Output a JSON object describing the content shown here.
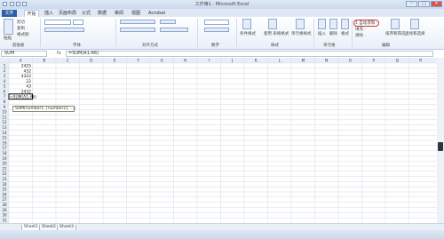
{
  "window": {
    "title": "工作簿1 - Microsoft Excel",
    "minimize_symbol": "–",
    "maximize_symbol": "□",
    "close_symbol": "✕"
  },
  "tabs": [
    {
      "label": "文件"
    },
    {
      "label": "开始"
    },
    {
      "label": "插入"
    },
    {
      "label": "页面布局"
    },
    {
      "label": "公式"
    },
    {
      "label": "数据"
    },
    {
      "label": "审阅"
    },
    {
      "label": "视图"
    },
    {
      "label": "Acrobat"
    }
  ],
  "ribbon": {
    "clipboard": {
      "cut": "剪切",
      "copy": "复制 ·",
      "format_painter": "格式刷",
      "paste": "粘贴",
      "group": "剪贴板"
    },
    "font_group": "字体",
    "alignment_group": "对齐方式",
    "number_group": "数字",
    "styles": {
      "conditional": "条件格式",
      "table": "套用 表格格式",
      "cell": "单元格样式",
      "group": "样式"
    },
    "cells": {
      "insert": "插入",
      "delete": "删除",
      "format": "格式",
      "group": "单元格"
    },
    "editing": {
      "autosum": "Σ 自动求和 ·",
      "fill": "填充 ·",
      "clear": "清除 ·",
      "sort": "排序和筛选",
      "find": "查找和选择",
      "group": "编辑"
    }
  },
  "formula_bar": {
    "name_box": "SUM",
    "fx": "fx",
    "formula": "=SUM(A1:A6)"
  },
  "columns": [
    "A",
    "B",
    "C",
    "D",
    "E",
    "F",
    "G",
    "H",
    "I",
    "J",
    "K",
    "L",
    "M",
    "N",
    "O",
    "P",
    "Q",
    "R"
  ],
  "rows": [
    "1",
    "2",
    "3",
    "4",
    "5",
    "6",
    "7",
    "8",
    "9",
    "10",
    "11",
    "12",
    "13",
    "14",
    "15",
    "16",
    "17",
    "18",
    "19",
    "20",
    "21",
    "22",
    "23",
    "24",
    "25",
    "26",
    "27",
    "28",
    "29",
    "30",
    "31"
  ],
  "cells": {
    "A1": "2425",
    "A2": "432",
    "A3": "4322",
    "A4": "22",
    "A5": "43",
    "A6": "2432",
    "A7": "=SUM(A1:A6)"
  },
  "tooltip": "SUM(number1, [number2], ...)",
  "sheets": [
    "Sheet1",
    "Sheet2",
    "Sheet3"
  ]
}
